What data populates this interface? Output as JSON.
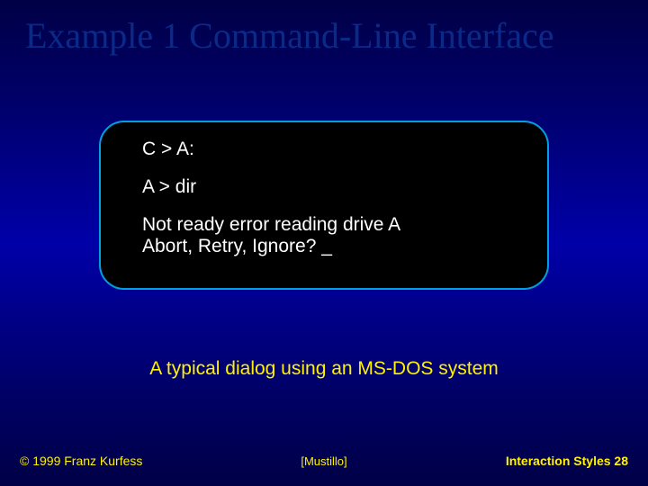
{
  "title": "Example 1 Command-Line Interface",
  "terminal": {
    "line1": "C > A:",
    "line2": "A > dir",
    "line3": "Not ready error reading drive A",
    "line4": "Abort, Retry, Ignore? ",
    "cursor": "_"
  },
  "caption": "A typical dialog using an MS-DOS system",
  "footer": {
    "copyright": "© 1999 Franz Kurfess",
    "citation": "[Mustillo]",
    "page_label": "Interaction Styles  ",
    "page_number": "28"
  }
}
